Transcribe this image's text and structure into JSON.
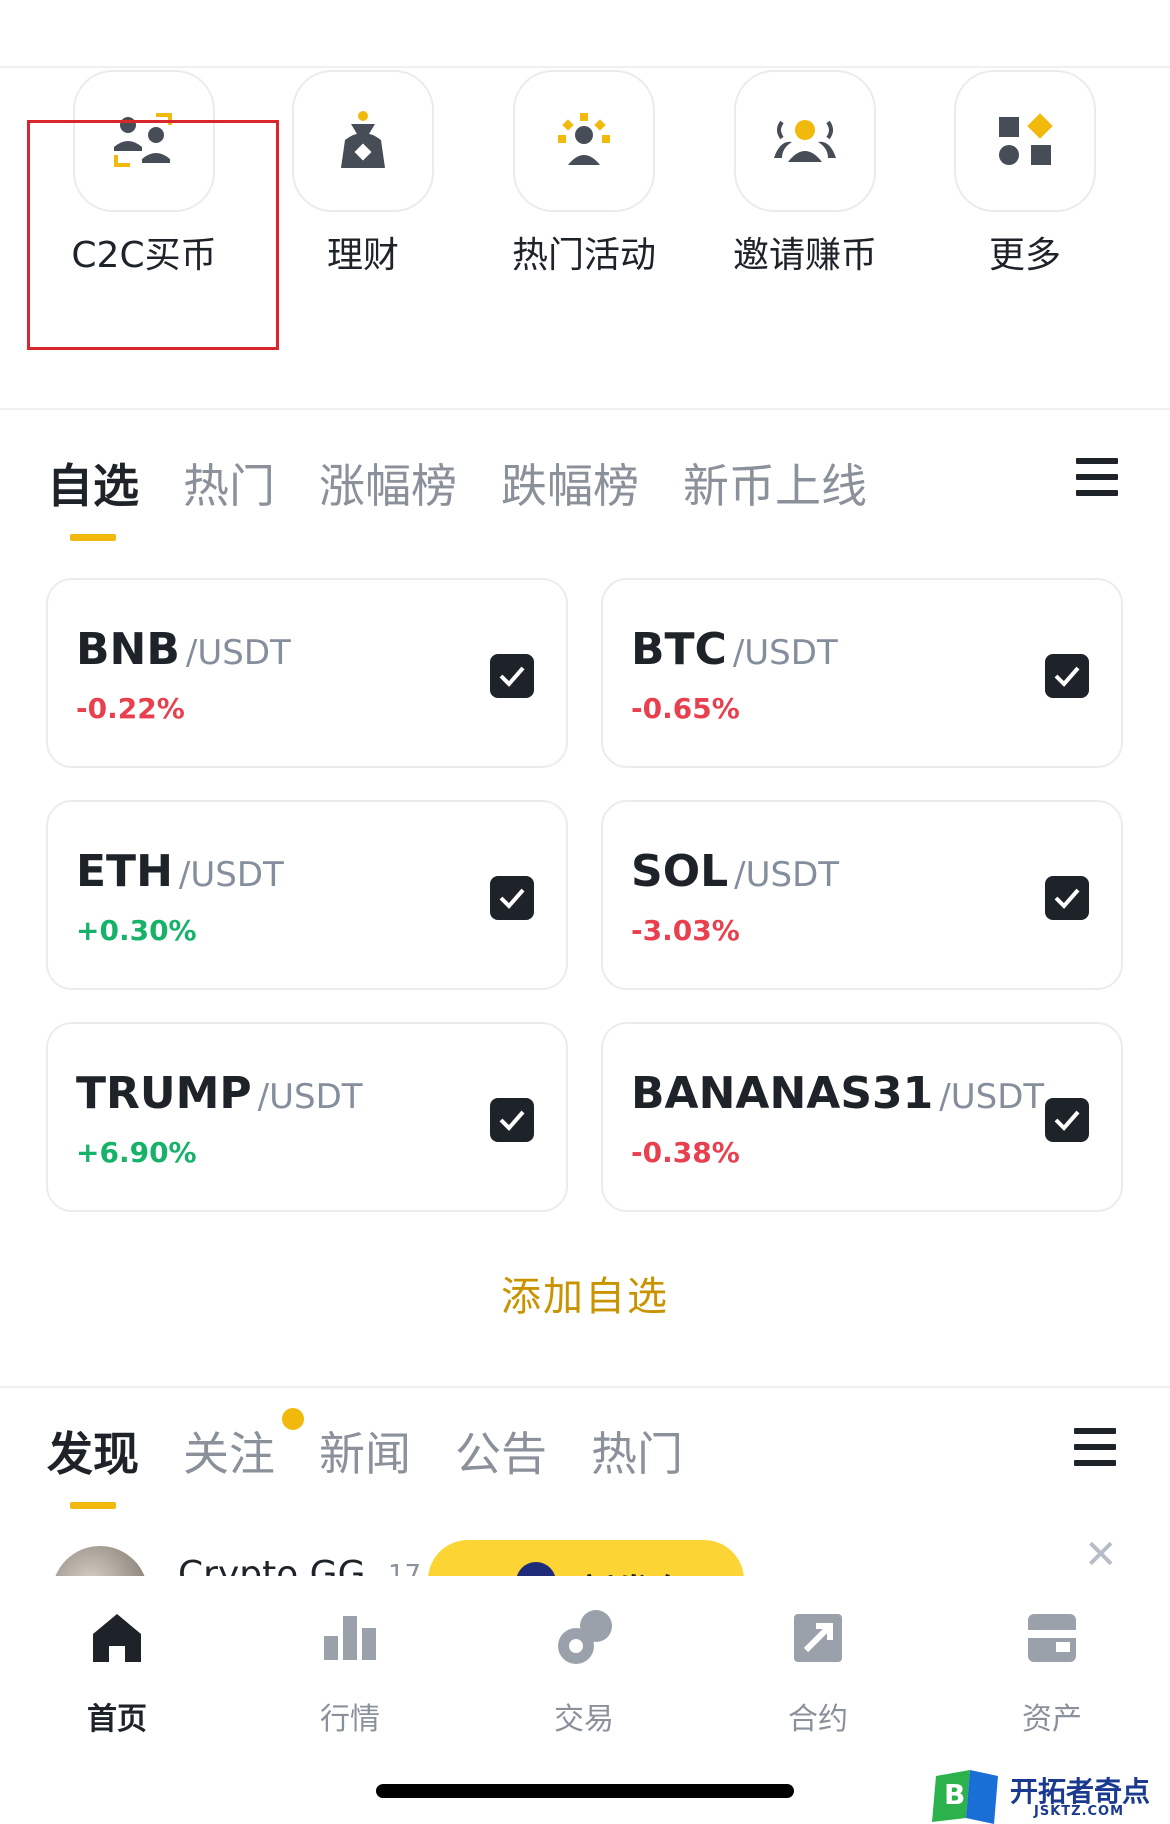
{
  "shortcuts": [
    {
      "label": "C2C买币",
      "icon": "c2c-people-icon"
    },
    {
      "label": "理财",
      "icon": "money-bag-icon"
    },
    {
      "label": "热门活动",
      "icon": "hot-activity-icon"
    },
    {
      "label": "邀请赚币",
      "icon": "invite-group-icon"
    },
    {
      "label": "更多",
      "icon": "more-shapes-icon"
    }
  ],
  "market_tabs": [
    "自选",
    "热门",
    "涨幅榜",
    "跌幅榜",
    "新币上线"
  ],
  "market_tab_active": "自选",
  "pairs": [
    {
      "base": "BNB",
      "quote": "/USDT",
      "change": "-0.22%",
      "trend": "neg",
      "checked": true
    },
    {
      "base": "BTC",
      "quote": "/USDT",
      "change": "-0.65%",
      "trend": "neg",
      "checked": true
    },
    {
      "base": "ETH",
      "quote": "/USDT",
      "change": "+0.30%",
      "trend": "pos",
      "checked": true
    },
    {
      "base": "SOL",
      "quote": "/USDT",
      "change": "-3.03%",
      "trend": "neg",
      "checked": true
    },
    {
      "base": "TRUMP",
      "quote": "/USDT",
      "change": "+6.90%",
      "trend": "pos",
      "checked": true
    },
    {
      "base": "BANANAS31",
      "quote": "/USDT",
      "change": "-0.38%",
      "trend": "neg",
      "checked": true
    }
  ],
  "add_favorites_label": "添加自选",
  "feed_tabs": [
    "发现",
    "关注",
    "新闻",
    "公告",
    "热门"
  ],
  "feed_tab_active": "发现",
  "feed_peek": {
    "author": "Crypto GG",
    "meta": "17",
    "new_post_label": "新发布"
  },
  "bottom_nav": [
    {
      "label": "首页",
      "icon": "home-icon",
      "active": true
    },
    {
      "label": "行情",
      "icon": "bar-chart-icon",
      "active": false
    },
    {
      "label": "交易",
      "icon": "trade-icon",
      "active": false
    },
    {
      "label": "合约",
      "icon": "futures-icon",
      "active": false
    },
    {
      "label": "资产",
      "icon": "wallet-icon",
      "active": false
    }
  ],
  "watermark": {
    "title": "开拓者奇点",
    "sub": "JSKTZ.COM"
  },
  "colors": {
    "accent": "#f0b90b",
    "negative": "#e8404e",
    "positive": "#17b26a",
    "text": "#1e2329",
    "muted": "#8a919b"
  }
}
